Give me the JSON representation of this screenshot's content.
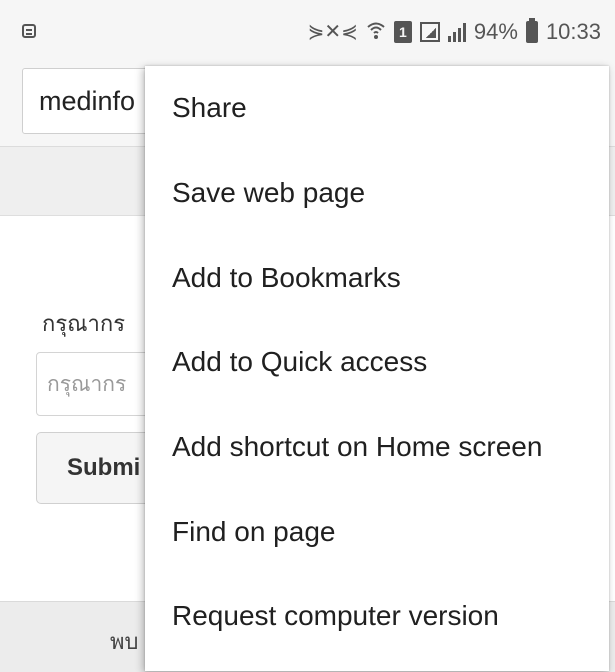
{
  "status_bar": {
    "battery_percent": "94%",
    "time": "10:33",
    "sim_label": "1",
    "icons": [
      "notification-icon",
      "mute-icon",
      "wifi-icon",
      "sim-icon",
      "signal-icon",
      "signal-icon",
      "battery-icon"
    ]
  },
  "browser": {
    "url_text": "medinfo"
  },
  "page": {
    "label_text": "กรุณากร",
    "input_placeholder": "กรุณากร",
    "submit_label": "Submi",
    "footer_text": "พบ"
  },
  "menu": {
    "items": [
      {
        "label": "Share"
      },
      {
        "label": "Save web page"
      },
      {
        "label": "Add to Bookmarks"
      },
      {
        "label": "Add to Quick access"
      },
      {
        "label": "Add shortcut on Home screen"
      },
      {
        "label": "Find on page"
      },
      {
        "label": "Request computer version"
      }
    ]
  },
  "colors": {
    "status_bar_bg": "#f6f6f6",
    "menu_bg": "#ffffff",
    "text": "#202020"
  }
}
